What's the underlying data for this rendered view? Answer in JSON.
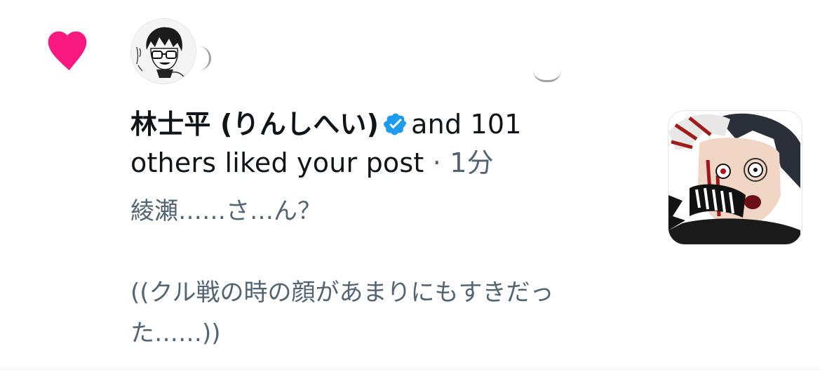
{
  "notification": {
    "actor_name": "林士平 (りんしへい)",
    "liked_text_before_time": "and 101 others liked your post",
    "separator": "·",
    "timestamp": "1分",
    "post_text": "綾瀬……さ…ん？\n\n((クル戦の時の顔があまりにもすきだった……))",
    "icons": {
      "type": "heart-icon",
      "verified": "verified-badge-icon"
    },
    "colors": {
      "heart": "#f91880",
      "verified": "#1d9bf0",
      "name": "#0f1419",
      "secondary": "#536471"
    }
  }
}
